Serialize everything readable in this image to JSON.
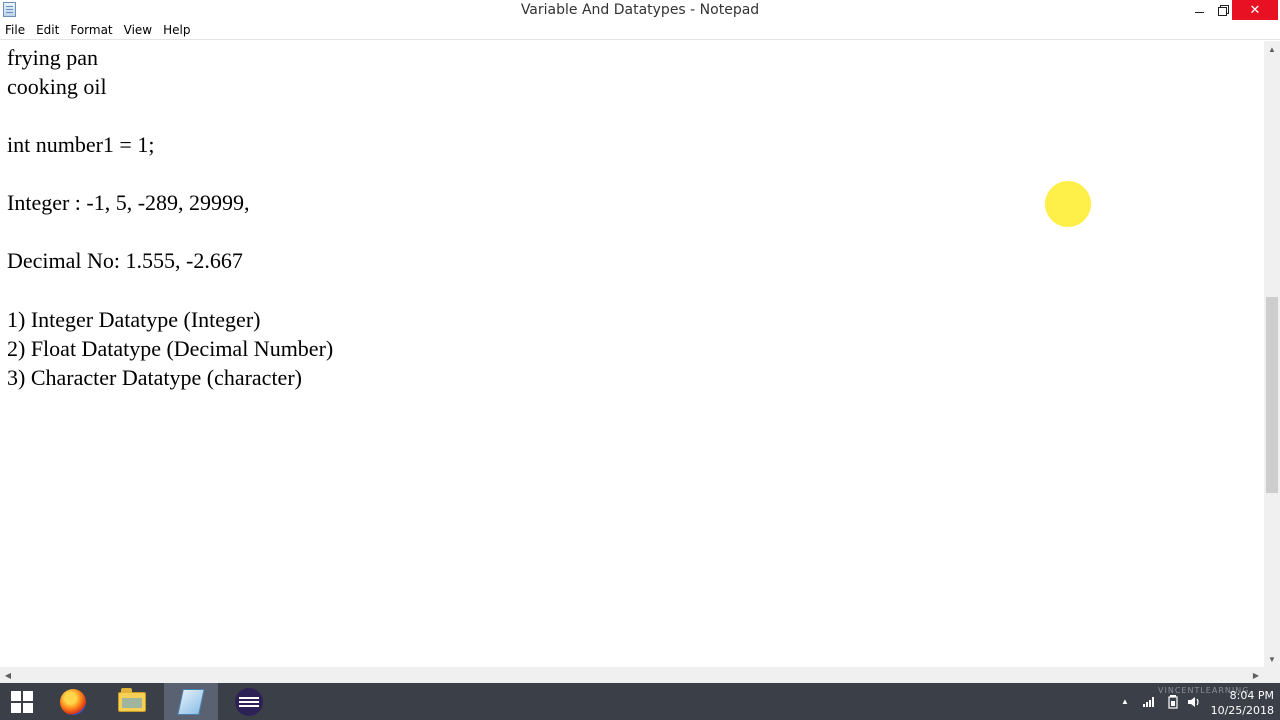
{
  "window": {
    "title": "Variable And Datatypes - Notepad",
    "controls": {
      "minimize": "",
      "maximize": "",
      "close": "✕"
    }
  },
  "menu": {
    "items": [
      "File",
      "Edit",
      "Format",
      "View",
      "Help"
    ]
  },
  "editor": {
    "lines": [
      "frying pan",
      "cooking oil",
      "",
      "int number1 = 1;",
      "",
      "Integer : -1, 5, -289, 29999,",
      "",
      "Decimal No: 1.555, -2.667",
      "",
      "1) Integer Datatype (Integer)",
      "2) Float Datatype (Decimal Number)",
      "3) Character Datatype (character)"
    ]
  },
  "scrollbars": {
    "up_arrow": "▲",
    "down_arrow": "▼",
    "left_arrow": "◀",
    "right_arrow": "▶"
  },
  "taskbar": {
    "apps": [
      "start-icon",
      "firefox-icon",
      "file-explorer-icon",
      "notepad-icon",
      "eclipse-icon"
    ],
    "tray": {
      "overflow_arrow": "▲",
      "time": "8:04 PM",
      "date": "10/25/2018",
      "watermark": "VINCENTLEARNING"
    }
  },
  "colors": {
    "close_button": "#e81123",
    "taskbar": "#3a3f48",
    "cursor_highlight": "#ffec28"
  }
}
